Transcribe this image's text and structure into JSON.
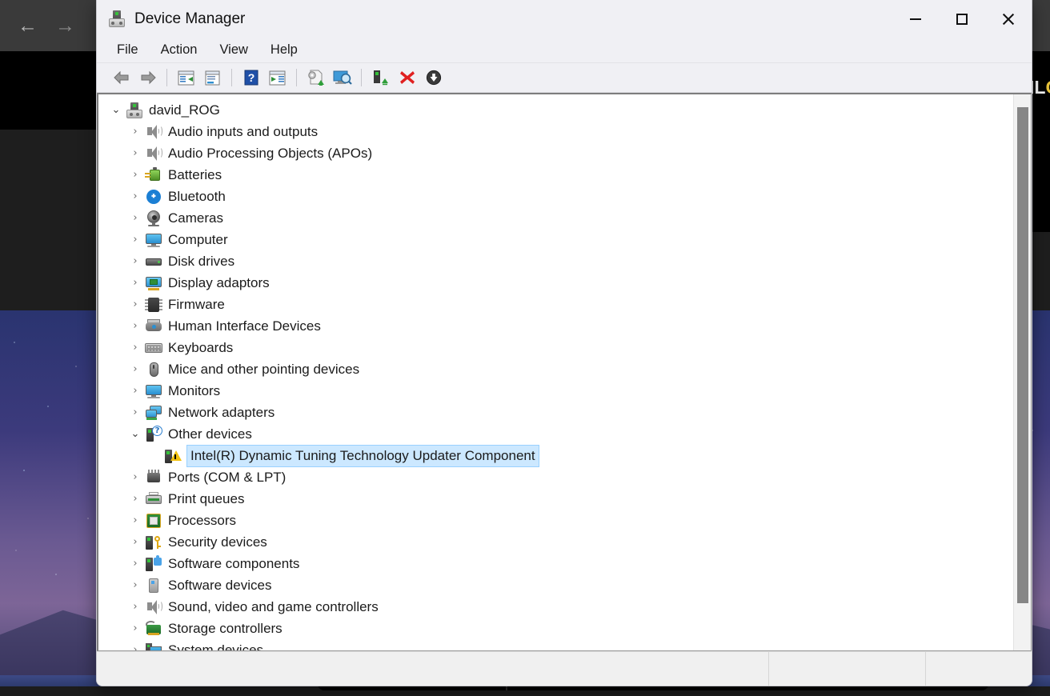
{
  "desktop": {
    "nav_back_icon": "←",
    "nav_forward_icon": "→",
    "edge_text_white": "IL",
    "edge_text_yellow": "O"
  },
  "window": {
    "title": "Device Manager",
    "app_icon": "device-manager-icon",
    "controls": {
      "minimize": "minimize",
      "maximize": "maximize",
      "close": "close"
    }
  },
  "menubar": {
    "items": [
      {
        "label": "File"
      },
      {
        "label": "Action"
      },
      {
        "label": "View"
      },
      {
        "label": "Help"
      }
    ]
  },
  "toolbar": {
    "buttons": [
      {
        "name": "back-button",
        "icon": "back-arrow-icon"
      },
      {
        "name": "forward-button",
        "icon": "forward-arrow-icon"
      },
      {
        "name": "show-hide-console-tree",
        "icon": "console-tree-icon"
      },
      {
        "name": "properties-button",
        "icon": "properties-icon"
      },
      {
        "name": "help-button",
        "icon": "help-question-icon"
      },
      {
        "name": "show-hide-action-pane",
        "icon": "action-pane-icon"
      },
      {
        "name": "update-driver-button",
        "icon": "update-driver-icon"
      },
      {
        "name": "scan-hardware-changes",
        "icon": "scan-hardware-icon"
      },
      {
        "name": "enable-device-button",
        "icon": "enable-device-icon"
      },
      {
        "name": "uninstall-device-button",
        "icon": "uninstall-red-x-icon"
      },
      {
        "name": "disable-device-button",
        "icon": "disable-down-arrow-icon"
      }
    ]
  },
  "tree": {
    "root": {
      "label": "david_ROG",
      "icon": "computer-root-icon",
      "expanded": true,
      "chevron": "⌄"
    },
    "collapsed_chevron": "›",
    "expanded_chevron": "⌄",
    "nodes": [
      {
        "label": "Audio inputs and outputs",
        "icon": "speaker-icon",
        "expanded": false,
        "selected": false,
        "level": 1
      },
      {
        "label": "Audio Processing Objects (APOs)",
        "icon": "speaker-icon",
        "expanded": false,
        "selected": false,
        "level": 1
      },
      {
        "label": "Batteries",
        "icon": "battery-icon",
        "expanded": false,
        "selected": false,
        "level": 1
      },
      {
        "label": "Bluetooth",
        "icon": "bluetooth-icon",
        "expanded": false,
        "selected": false,
        "level": 1
      },
      {
        "label": "Cameras",
        "icon": "camera-icon",
        "expanded": false,
        "selected": false,
        "level": 1
      },
      {
        "label": "Computer",
        "icon": "monitor-icon",
        "expanded": false,
        "selected": false,
        "level": 1
      },
      {
        "label": "Disk drives",
        "icon": "disk-drive-icon",
        "expanded": false,
        "selected": false,
        "level": 1
      },
      {
        "label": "Display adaptors",
        "icon": "display-adapter-icon",
        "expanded": false,
        "selected": false,
        "level": 1
      },
      {
        "label": "Firmware",
        "icon": "firmware-chip-icon",
        "expanded": false,
        "selected": false,
        "level": 1
      },
      {
        "label": "Human Interface Devices",
        "icon": "hid-icon",
        "expanded": false,
        "selected": false,
        "level": 1
      },
      {
        "label": "Keyboards",
        "icon": "keyboard-icon",
        "expanded": false,
        "selected": false,
        "level": 1
      },
      {
        "label": "Mice and other pointing devices",
        "icon": "mouse-icon",
        "expanded": false,
        "selected": false,
        "level": 1
      },
      {
        "label": "Monitors",
        "icon": "monitor-icon",
        "expanded": false,
        "selected": false,
        "level": 1
      },
      {
        "label": "Network adapters",
        "icon": "network-adapter-icon",
        "expanded": false,
        "selected": false,
        "level": 1
      },
      {
        "label": "Other devices",
        "icon": "other-devices-icon",
        "expanded": true,
        "selected": false,
        "level": 1
      },
      {
        "label": "Intel(R) Dynamic Tuning Technology Updater Component",
        "icon": "unknown-device-warning-icon",
        "expanded": false,
        "selected": true,
        "level": 2
      },
      {
        "label": "Ports (COM & LPT)",
        "icon": "port-icon",
        "expanded": false,
        "selected": false,
        "level": 1
      },
      {
        "label": "Print queues",
        "icon": "printer-icon",
        "expanded": false,
        "selected": false,
        "level": 1
      },
      {
        "label": "Processors",
        "icon": "processor-icon",
        "expanded": false,
        "selected": false,
        "level": 1
      },
      {
        "label": "Security devices",
        "icon": "security-key-icon",
        "expanded": false,
        "selected": false,
        "level": 1
      },
      {
        "label": "Software components",
        "icon": "software-component-icon",
        "expanded": false,
        "selected": false,
        "level": 1
      },
      {
        "label": "Software devices",
        "icon": "software-device-icon",
        "expanded": false,
        "selected": false,
        "level": 1
      },
      {
        "label": "Sound, video and game controllers",
        "icon": "speaker-icon",
        "expanded": false,
        "selected": false,
        "level": 1
      },
      {
        "label": "Storage controllers",
        "icon": "storage-controller-icon",
        "expanded": false,
        "selected": false,
        "level": 1
      },
      {
        "label": "System devices",
        "icon": "system-device-icon",
        "expanded": false,
        "selected": false,
        "level": 1
      }
    ]
  },
  "statusbar": {
    "main_text": "",
    "cell2_text": "",
    "cell3_text": ""
  },
  "colors": {
    "selection": "#cce8ff",
    "window_chrome": "#f0f0f4",
    "tree_background": "#ffffff",
    "warning_yellow": "#f2c10f",
    "bluetooth_blue": "#1b7fd4"
  }
}
